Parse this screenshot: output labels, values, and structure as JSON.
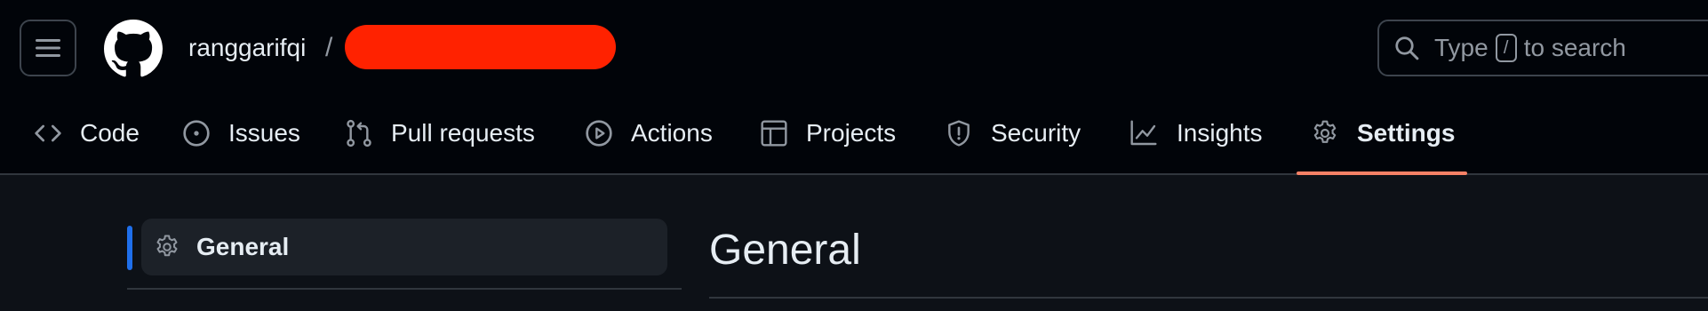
{
  "header": {
    "owner": "ranggarifqi",
    "path_separator": "/",
    "redaction_color": "#ff2200",
    "search": {
      "text_before": "Type",
      "shortcut_key": "/",
      "text_after": "to search"
    }
  },
  "nav": {
    "tabs": [
      {
        "label": "Code",
        "icon": "code-icon"
      },
      {
        "label": "Issues",
        "icon": "issue-opened-icon"
      },
      {
        "label": "Pull requests",
        "icon": "git-pull-request-icon"
      },
      {
        "label": "Actions",
        "icon": "play-icon"
      },
      {
        "label": "Projects",
        "icon": "table-icon"
      },
      {
        "label": "Security",
        "icon": "shield-icon"
      },
      {
        "label": "Insights",
        "icon": "graph-icon"
      },
      {
        "label": "Settings",
        "icon": "gear-icon",
        "selected": true
      }
    ],
    "selected_underline_color": "#f78166"
  },
  "sidebar": {
    "items": [
      {
        "label": "General",
        "icon": "gear-icon",
        "selected": true
      }
    ],
    "selected_indicator_color": "#1f6feb"
  },
  "main": {
    "title": "General"
  }
}
